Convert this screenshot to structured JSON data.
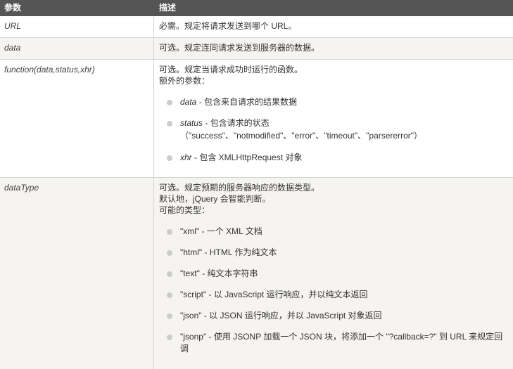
{
  "header": {
    "col_param": "参数",
    "col_desc": "描述"
  },
  "rows": [
    {
      "param": "URL",
      "desc": "必需。规定将请求发送到哪个 URL。"
    },
    {
      "param": "data",
      "desc": "可选。规定连同请求发送到服务器的数据。"
    },
    {
      "param": "function(data,status,xhr)",
      "desc_lines": [
        "可选。规定当请求成功时运行的函数。",
        "额外的参数："
      ],
      "items": [
        {
          "name": "data",
          "text": " - 包含来自请求的结果数据"
        },
        {
          "name": "status",
          "text": " - 包含请求的状态",
          "extra": "（\"success\"、\"notmodified\"、\"error\"、\"timeout\"、\"parsererror\"）"
        },
        {
          "name": "xhr",
          "text": " - 包含 XMLHttpRequest 对象"
        }
      ]
    },
    {
      "param": "dataType",
      "desc_lines": [
        "可选。规定预期的服务器响应的数据类型。",
        "默认地，jQuery 会智能判断。",
        "可能的类型："
      ],
      "items": [
        {
          "text": "\"xml\" - 一个 XML 文档"
        },
        {
          "text": "\"html\" - HTML 作为纯文本"
        },
        {
          "text": "\"text\" - 纯文本字符串"
        },
        {
          "text": "\"script\" - 以 JavaScript 运行响应，并以纯文本返回"
        },
        {
          "text": "\"json\" - 以 JSON 运行响应，并以 JavaScript 对象返回"
        },
        {
          "text": "\"jsonp\" - 使用 JSONP 加载一个 JSON 块，将添加一个 \"?callback=?\" 到 URL 来规定回",
          "extra": "调"
        }
      ]
    }
  ]
}
